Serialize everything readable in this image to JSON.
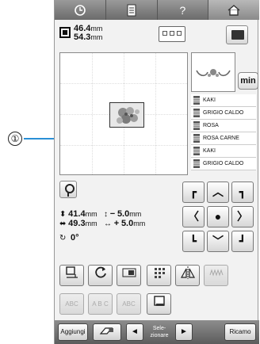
{
  "callout": {
    "number": "①"
  },
  "topbar": {
    "clock_icon": "clock-icon",
    "page_icon": "page-icon",
    "help_label": "?",
    "home_icon": "home-icon"
  },
  "size": {
    "width_value": "46.4",
    "height_value": "54.3",
    "unit": "mm"
  },
  "threads": [
    {
      "name": "KAKI"
    },
    {
      "name": "GRIGIO CALDO"
    },
    {
      "name": "ROSA"
    },
    {
      "name": "ROSA CARNE"
    },
    {
      "name": "KAKI"
    },
    {
      "name": "GRIGIO CALDO"
    }
  ],
  "min_button": {
    "label": "min"
  },
  "info": {
    "height_value": "41.4",
    "width_value": "49.3",
    "unit": "mm",
    "vert_offset_sign": "−",
    "vert_offset_value": "5.0",
    "horiz_offset_sign": "+",
    "horiz_offset_value": "5.0",
    "angle_value": "0°"
  },
  "arrows": {
    "center_label": "●"
  },
  "tools": {
    "abc_label": "ABC",
    "abc_arc_label": "A B C",
    "border_label": "ABC"
  },
  "bottombar": {
    "add_label": "Aggiungi",
    "select_label_1": "Sele-",
    "select_label_2": "zionare",
    "recall_label": "Ricamo",
    "prev_label": "◄",
    "next_label": "►"
  },
  "colors": {
    "callout_line": "#2a8fd6",
    "bar_dark": "#6b6b6b"
  }
}
